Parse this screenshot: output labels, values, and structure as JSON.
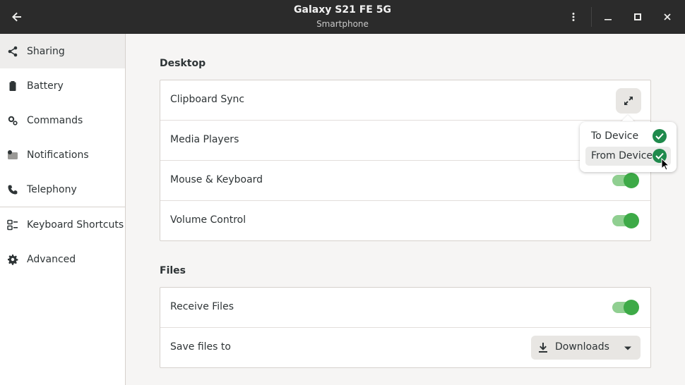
{
  "header": {
    "title": "Galaxy S21 FE 5G",
    "subtitle": "Smartphone",
    "back_icon": "back-arrow-icon",
    "menu_icon": "vertical-dots-icon",
    "minimize_icon": "minimize-icon",
    "maximize_icon": "maximize-icon",
    "close_icon": "close-icon"
  },
  "sidebar": {
    "items": [
      {
        "label": "Sharing",
        "icon": "share-icon",
        "active": true
      },
      {
        "label": "Battery",
        "icon": "battery-icon",
        "active": false
      },
      {
        "label": "Commands",
        "icon": "commands-icon",
        "active": false
      },
      {
        "label": "Notifications",
        "icon": "notifications-icon",
        "active": false
      },
      {
        "label": "Telephony",
        "icon": "phone-icon",
        "active": false
      },
      {
        "label": "Keyboard Shortcuts",
        "icon": "keyboard-shortcuts-icon",
        "active": false
      },
      {
        "label": "Advanced",
        "icon": "gear-icon",
        "active": false
      }
    ]
  },
  "desktop": {
    "title": "Desktop",
    "rows": [
      {
        "label": "Clipboard Sync",
        "control": "icon-button",
        "icon": "sync-arrows-icon"
      },
      {
        "label": "Media Players",
        "control": "switch",
        "on": true
      },
      {
        "label": "Mouse & Keyboard",
        "control": "switch",
        "on": true
      },
      {
        "label": "Volume Control",
        "control": "switch",
        "on": true
      }
    ]
  },
  "files": {
    "title": "Files",
    "rows": [
      {
        "label": "Receive Files",
        "control": "switch",
        "on": true
      },
      {
        "label": "Save files to",
        "control": "dropdown",
        "value": "Downloads",
        "icon": "download-icon"
      }
    ]
  },
  "popover": {
    "items": [
      {
        "label": "To Device",
        "checked": true
      },
      {
        "label": "From Device",
        "checked": true
      }
    ]
  },
  "colors": {
    "headerbar": "#2b2b2b",
    "accent_green": "#3daa47",
    "switch_track": "#90cf91",
    "check_green": "#1f8a4c"
  }
}
